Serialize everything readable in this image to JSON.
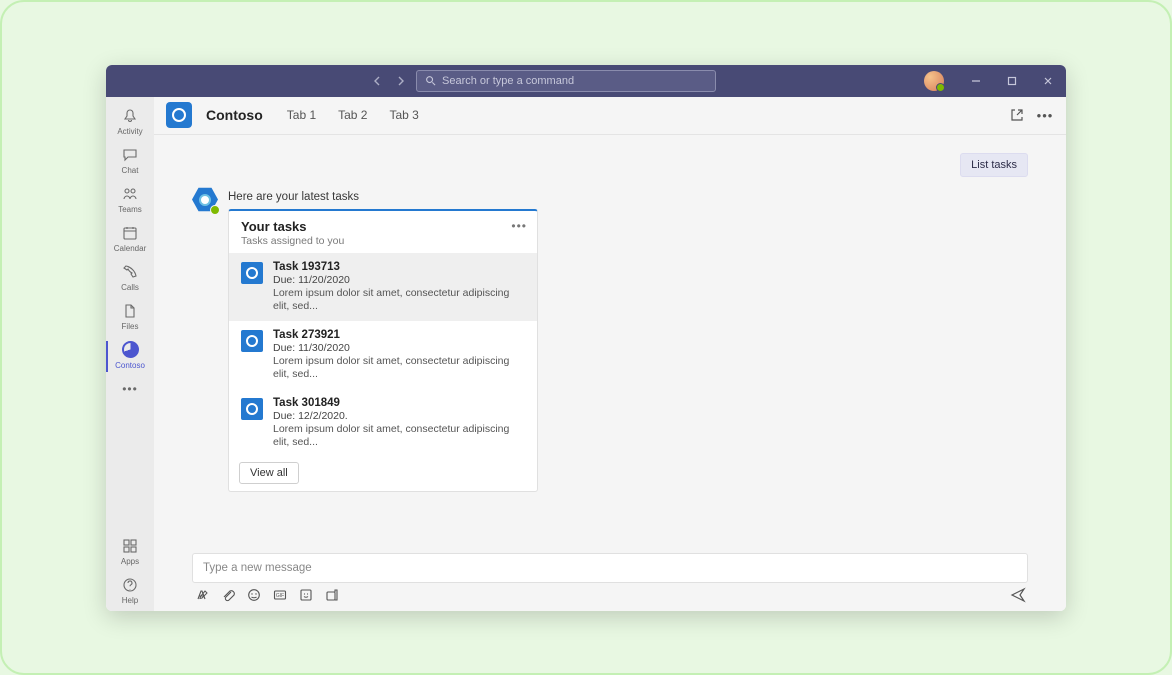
{
  "titlebar": {
    "search_placeholder": "Search or type a command",
    "minimize_label": "Minimize",
    "maximize_label": "Maximize",
    "close_label": "Close"
  },
  "rail": {
    "items": [
      {
        "id": "activity",
        "label": "Activity"
      },
      {
        "id": "chat",
        "label": "Chat"
      },
      {
        "id": "teams",
        "label": "Teams"
      },
      {
        "id": "calendar",
        "label": "Calendar"
      },
      {
        "id": "calls",
        "label": "Calls"
      },
      {
        "id": "files",
        "label": "Files"
      },
      {
        "id": "contoso",
        "label": "Contoso"
      }
    ],
    "bottom": [
      {
        "id": "apps",
        "label": "Apps"
      },
      {
        "id": "help",
        "label": "Help"
      }
    ]
  },
  "header": {
    "app_name": "Contoso",
    "tabs": [
      "Tab 1",
      "Tab 2",
      "Tab 3"
    ]
  },
  "user_message": "List tasks",
  "bot": {
    "intro": "Here are your latest tasks",
    "card_title": "Your tasks",
    "card_subtitle": "Tasks assigned to you",
    "tasks": [
      {
        "title": "Task 193713",
        "due": "Due: 11/20/2020",
        "desc": "Lorem ipsum dolor sit amet, consectetur adipiscing elit, sed..."
      },
      {
        "title": "Task 273921",
        "due": "Due: 11/30/2020",
        "desc": "Lorem ipsum dolor sit amet, consectetur adipiscing elit, sed..."
      },
      {
        "title": "Task 301849",
        "due": "Due: 12/2/2020.",
        "desc": "Lorem ipsum dolor sit amet, consectetur adipiscing elit, sed..."
      }
    ],
    "view_all": "View all"
  },
  "compose": {
    "placeholder": "Type a new message"
  },
  "colors": {
    "accent": "#4c56cf",
    "brand": "#2479d0",
    "titlebar": "#484a75"
  }
}
